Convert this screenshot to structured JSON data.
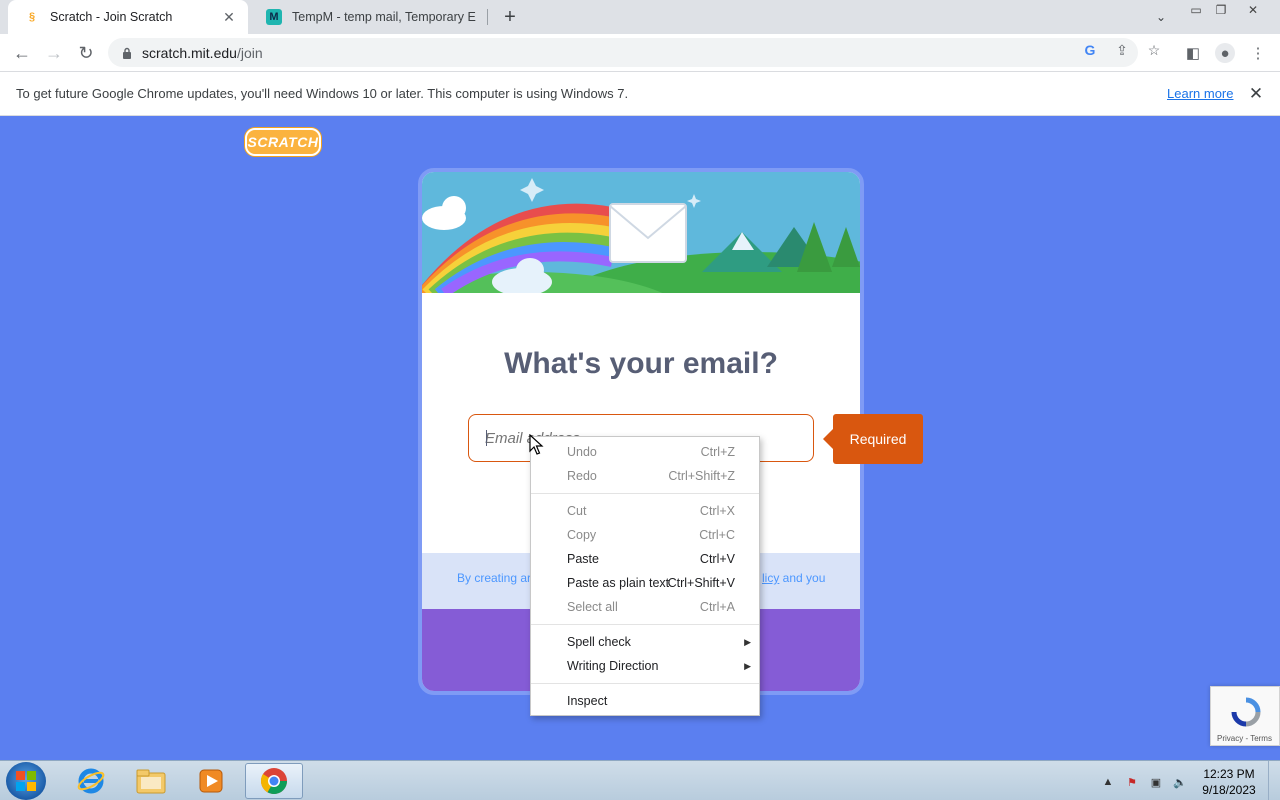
{
  "browser": {
    "tabs": [
      {
        "title": "Scratch - Join Scratch",
        "icon": "scratch-favicon"
      },
      {
        "title": "TempM - temp mail, Temporary E",
        "icon": "tempm-favicon"
      }
    ],
    "url_host": "scratch.mit.edu",
    "url_path": "/join"
  },
  "infobar": {
    "message": "To get future Google Chrome updates, you'll need Windows 10 or later. This computer is using Windows 7.",
    "learn_more": "Learn more"
  },
  "page": {
    "logo_text": "SCRATCH",
    "heading": "What's your email?",
    "email_placeholder": "Email address",
    "required_label": "Required",
    "terms_left": "By creating ar",
    "terms_right_link": "licy",
    "terms_right": " and you"
  },
  "context_menu": {
    "items": [
      {
        "label": "Undo",
        "shortcut": "Ctrl+Z",
        "enabled": false
      },
      {
        "label": "Redo",
        "shortcut": "Ctrl+Shift+Z",
        "enabled": false
      },
      {
        "label": "Cut",
        "shortcut": "Ctrl+X",
        "enabled": false
      },
      {
        "label": "Copy",
        "shortcut": "Ctrl+C",
        "enabled": false
      },
      {
        "label": "Paste",
        "shortcut": "Ctrl+V",
        "enabled": true
      },
      {
        "label": "Paste as plain text",
        "shortcut": "Ctrl+Shift+V",
        "enabled": true
      },
      {
        "label": "Select all",
        "shortcut": "Ctrl+A",
        "enabled": false
      },
      {
        "label": "Spell check",
        "shortcut": "",
        "enabled": true,
        "submenu": true
      },
      {
        "label": "Writing Direction",
        "shortcut": "",
        "enabled": true,
        "submenu": true
      },
      {
        "label": "Inspect",
        "shortcut": "",
        "enabled": true
      }
    ]
  },
  "recaptcha": {
    "label": "Privacy - Terms"
  },
  "taskbar": {
    "time": "12:23 PM",
    "date": "9/18/2023"
  },
  "colors": {
    "page_bg": "#5b7ff0",
    "required_bg": "#d9570f",
    "purple_band": "#855cd6",
    "heading": "#575e75"
  }
}
